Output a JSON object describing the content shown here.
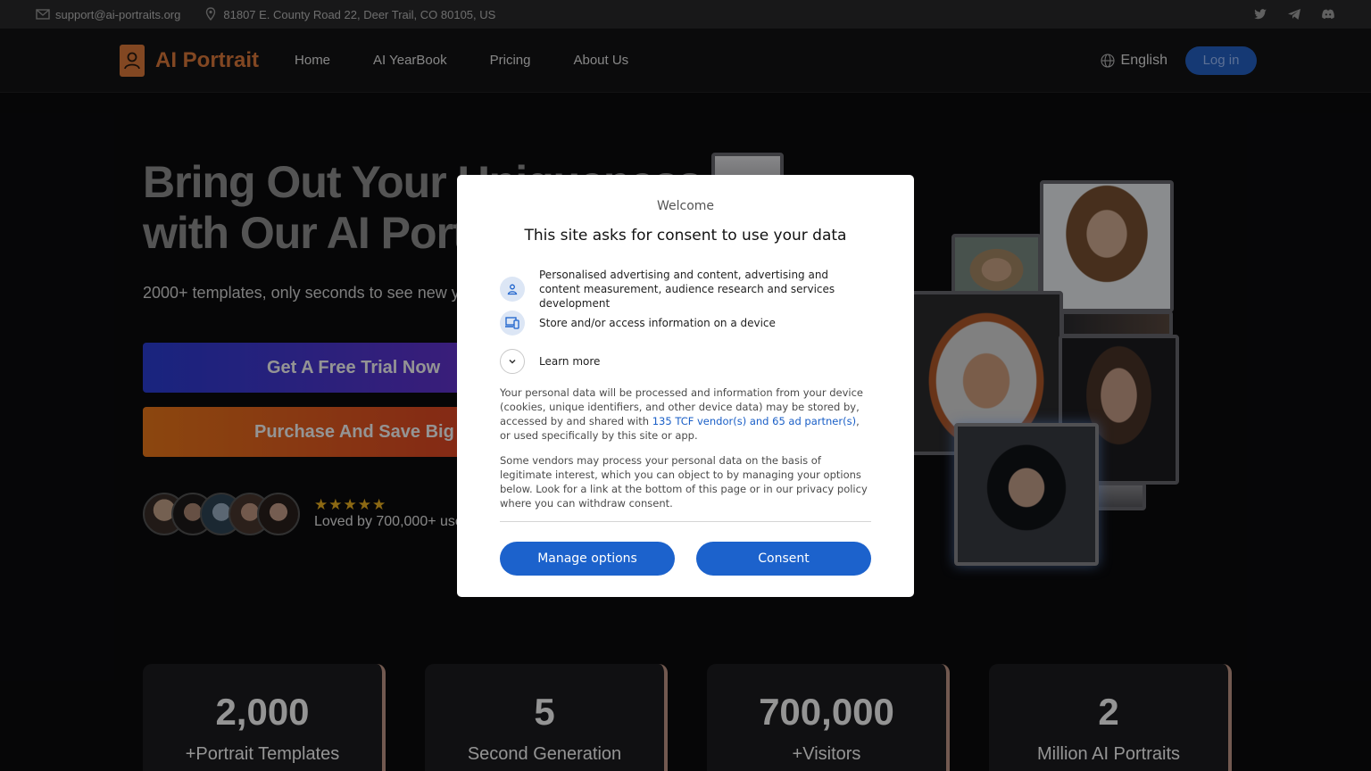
{
  "topbar": {
    "email": "support@ai-portraits.org",
    "address": "81807 E. County Road 22, Deer Trail, CO 80105, US",
    "socials": [
      "twitter-icon",
      "telegram-icon",
      "discord-icon"
    ]
  },
  "nav": {
    "brand": "AI Portrait",
    "links": [
      "Home",
      "AI YearBook",
      "Pricing",
      "About Us"
    ],
    "language": "English",
    "login": "Log in"
  },
  "hero": {
    "title_line1": "Bring Out Your Uniqueness",
    "title_line2": "with Our AI Portraits",
    "subtitle": "2000+ templates, only seconds to see new you",
    "trial_button": "Get A Free Trial Now",
    "buy_button": "Purchase And Save Big",
    "stars": "★★★★★",
    "loved": "Loved by 700,000+ users"
  },
  "stats": [
    {
      "num": "2,000",
      "label": "+Portrait Templates"
    },
    {
      "num": "5",
      "label": "Second Generation"
    },
    {
      "num": "700,000",
      "label": "+Visitors"
    },
    {
      "num": "2",
      "label": "Million AI Portraits"
    }
  ],
  "dialog": {
    "welcome": "Welcome",
    "title": "This site asks for consent to use your data",
    "purposes": [
      "Personalised advertising and content, advertising and content measurement, audience research and services development",
      "Store and/or access information on a device"
    ],
    "learn_more": "Learn more",
    "para1_before": "Your personal data will be processed and information from your device (cookies, unique identifiers, and other device data) may be stored by, accessed by and shared with ",
    "para1_link": "135 TCF vendor(s) and 65 ad partner(s)",
    "para1_after": ", or used specifically by this site or app.",
    "para2": "Some vendors may process your personal data on the basis of legitimate interest, which you can object to by managing your options below. Look for a link at the bottom of this page or in our privacy policy where you can withdraw consent.",
    "manage_button": "Manage options",
    "consent_button": "Consent"
  },
  "colors": {
    "brand": "#e07a3b",
    "dialog_button": "#1c62cc",
    "link": "#1a5fc7"
  }
}
